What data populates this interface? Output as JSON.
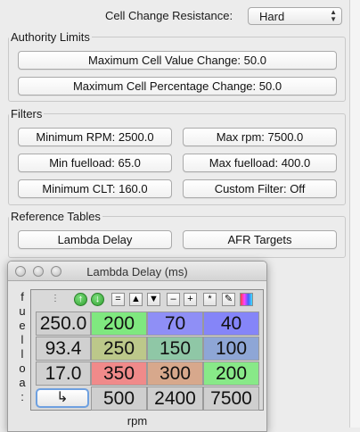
{
  "cell_change": {
    "label": "Cell Change Resistance:",
    "value": "Hard"
  },
  "authority": {
    "legend": "Authority Limits",
    "max_cell_value": "Maximum Cell Value Change: 50.0",
    "max_cell_pct": "Maximum Cell Percentage Change: 50.0"
  },
  "filters": {
    "legend": "Filters",
    "min_rpm": "Minimum RPM: 2500.0",
    "max_rpm": "Max rpm: 7500.0",
    "min_fuelload": "Min fuelload: 65.0",
    "max_fuelload": "Max fuelload: 400.0",
    "min_clt": "Minimum CLT: 160.0",
    "custom": "Custom Filter: Off"
  },
  "reference": {
    "legend": "Reference Tables",
    "lambda_delay": "Lambda Delay",
    "afr_targets": "AFR Targets"
  },
  "lambda_window": {
    "title": "Lambda Delay (ms)",
    "y_label_chars": [
      "f",
      "u",
      "e",
      "l",
      "l",
      "o",
      "a",
      ":"
    ],
    "x_label": "rpm",
    "toolbar": [
      "=",
      "▲",
      "▼",
      "–",
      "+",
      "*"
    ],
    "rows": [
      {
        "axis": "250.0",
        "cells": [
          "200",
          "70",
          "40"
        ]
      },
      {
        "axis": "93.4",
        "cells": [
          "250",
          "150",
          "100"
        ]
      },
      {
        "axis": "17.0",
        "cells": [
          "350",
          "300",
          "200"
        ]
      }
    ],
    "x_axis": [
      "500",
      "2400",
      "7500"
    ],
    "colors": {
      "r0": [
        "#7fe87f",
        "#8f8ff6",
        "#8585f8"
      ],
      "r1": [
        "#bcc88a",
        "#8fc7a6",
        "#8ea6d6"
      ],
      "r2": [
        "#f08a8a",
        "#d7a88c",
        "#88e988"
      ]
    }
  }
}
